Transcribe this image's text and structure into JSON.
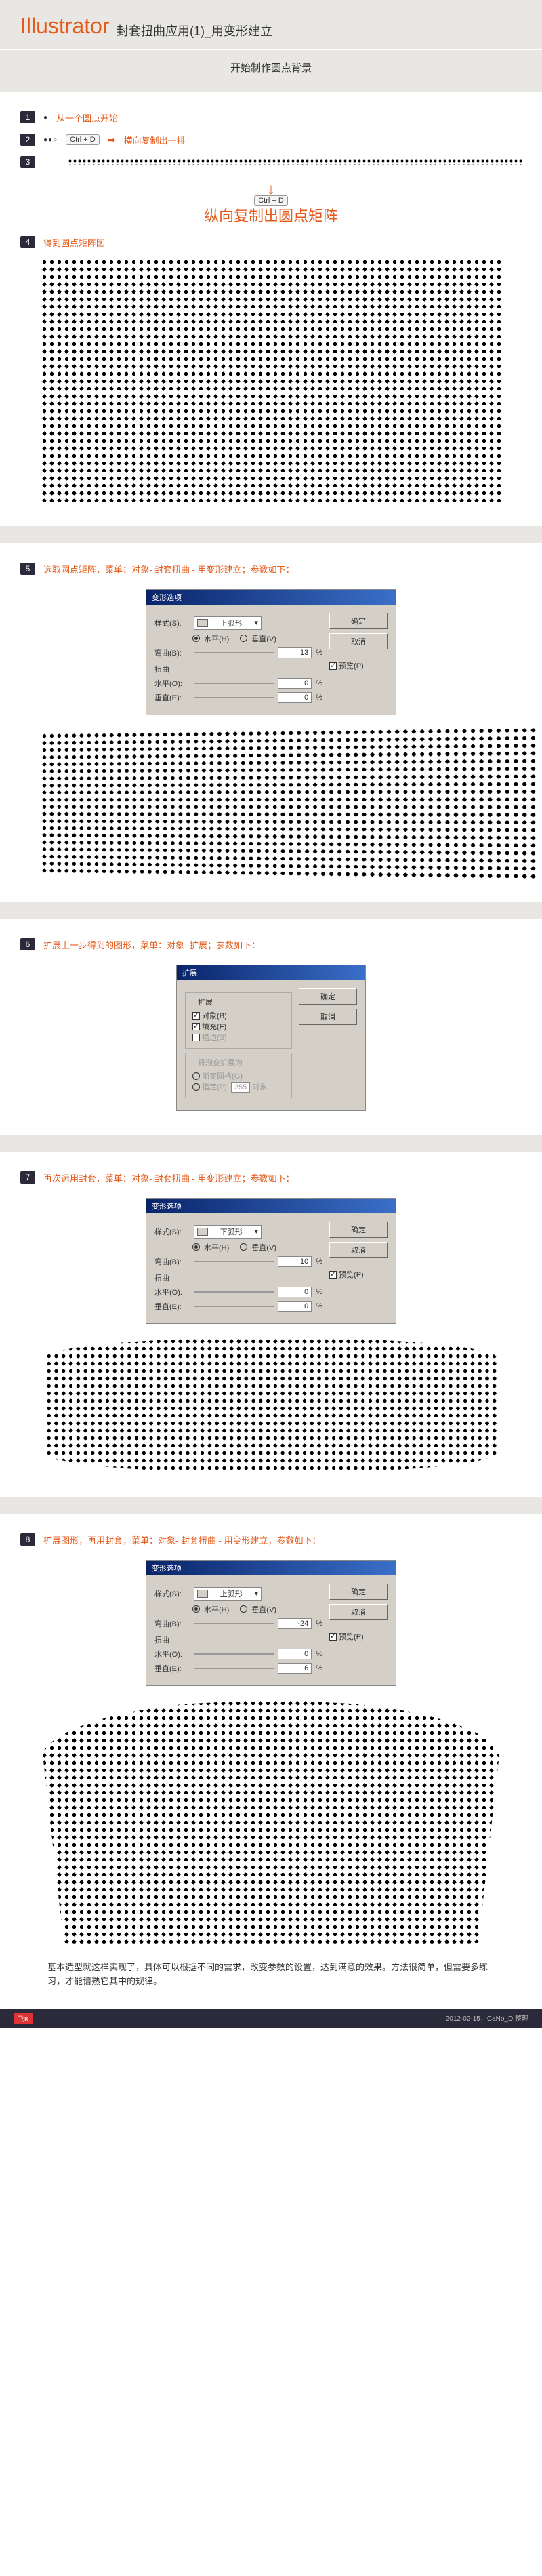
{
  "header": {
    "title": "Illustrator",
    "subtitle": "封套扭曲应用(1)_用变形建立"
  },
  "section1": {
    "title": "开始制作圆点背景"
  },
  "steps": {
    "s1": {
      "num": "1",
      "text": "从一个圆点开始"
    },
    "s2": {
      "num": "2",
      "kbd": "Ctrl + D",
      "text": "横向复制出一排"
    },
    "s3": {
      "num": "3",
      "kbd": "Ctrl + D",
      "text": "纵向复制出圆点矩阵"
    },
    "s4": {
      "num": "4",
      "text": "得到圆点矩阵图"
    },
    "s5": {
      "num": "5",
      "text": "选取圆点矩阵，菜单：对象- 封套扭曲 - 用变形建立；参数如下："
    },
    "s6": {
      "num": "6",
      "text": "扩展上一步得到的图形，菜单：对象- 扩展；参数如下："
    },
    "s7": {
      "num": "7",
      "text": "再次运用封套，菜单：对象- 封套扭曲 - 用变形建立；参数如下："
    },
    "s8": {
      "num": "8",
      "text": "扩展图形，再用封套，菜单：对象- 封套扭曲 - 用变形建立，参数如下："
    }
  },
  "dialog1": {
    "title": "变形选项",
    "style_label": "样式(S):",
    "style_value": "上弧形",
    "radio_h": "水平(H)",
    "radio_v": "垂直(V)",
    "bend_label": "弯曲(B):",
    "bend_value": "13",
    "pct": "%",
    "distort": "扭曲",
    "hdist_label": "水平(O):",
    "hdist_value": "0",
    "vdist_label": "垂直(E):",
    "vdist_value": "0",
    "ok": "确定",
    "cancel": "取消",
    "preview": "预览(P)"
  },
  "dialog2": {
    "title": "扩展",
    "group1": "扩展",
    "obj": "对象(B)",
    "fill": "填充(F)",
    "stroke": "描边(S)",
    "group2": "将渐变扩展为",
    "mesh": "渐变网格(G)",
    "specify": "指定(P):",
    "specify_value": "255",
    "objects": "对象",
    "ok": "确定",
    "cancel": "取消"
  },
  "dialog3": {
    "title": "变形选项",
    "style_label": "样式(S):",
    "style_value": "下弧形",
    "radio_h": "水平(H)",
    "radio_v": "垂直(V)",
    "bend_label": "弯曲(B):",
    "bend_value": "10",
    "pct": "%",
    "distort": "扭曲",
    "hdist_label": "水平(O):",
    "hdist_value": "0",
    "vdist_label": "垂直(E):",
    "vdist_value": "0",
    "ok": "确定",
    "cancel": "取消",
    "preview": "预览(P)"
  },
  "dialog4": {
    "title": "变形选项",
    "style_label": "样式(S):",
    "style_value": "上弧形",
    "radio_h": "水平(H)",
    "radio_v": "垂直(V)",
    "bend_label": "弯曲(B):",
    "bend_value": "-24",
    "pct": "%",
    "distort": "扭曲",
    "hdist_label": "水平(O):",
    "hdist_value": "0",
    "vdist_label": "垂直(E):",
    "vdist_value": "6",
    "ok": "确定",
    "cancel": "取消",
    "preview": "预览(P)"
  },
  "footer": {
    "note": "基本造型就这样实现了，具体可以根据不同的需求，改变参数的设置，达到满意的效果。方法很简单，但需要多练习，才能谙熟它其中的规律。",
    "logo": "飞K",
    "credit": "2012-02-15，CaNo_D 整理"
  }
}
